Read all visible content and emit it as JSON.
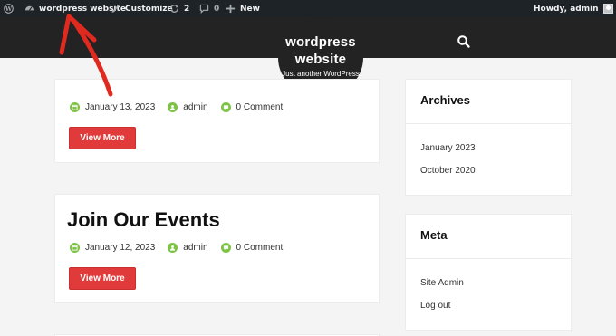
{
  "admin_bar": {
    "site_name": "wordpress website",
    "customize": "Customize",
    "updates_count": "2",
    "comments_count": "0",
    "new_label": "New",
    "howdy": "Howdy, admin",
    "icons": [
      "wordpress-logo-icon",
      "dashboard-icon",
      "brush-icon",
      "refresh-icon",
      "comment-icon",
      "plus-icon"
    ]
  },
  "site": {
    "title": "wordpress website",
    "tagline": "Just another WordPress site"
  },
  "posts": [
    {
      "title": "",
      "date": "January 13, 2023",
      "author": "admin",
      "comments": "0 Comment",
      "button": "View More"
    },
    {
      "title": "Join Our Events",
      "date": "January 12, 2023",
      "author": "admin",
      "comments": "0 Comment",
      "button": "View More"
    }
  ],
  "sidebar": {
    "archives": {
      "title": "Archives",
      "links": [
        "January 2023",
        "October 2020"
      ]
    },
    "meta": {
      "title": "Meta",
      "links": [
        "Site Admin",
        "Log out"
      ]
    }
  },
  "colors": {
    "admin_bar": "#1d2327",
    "header": "#232323",
    "accent_green": "#7cc243",
    "button_red": "#e03a3a",
    "annotation_arrow": "#e02a1f"
  }
}
